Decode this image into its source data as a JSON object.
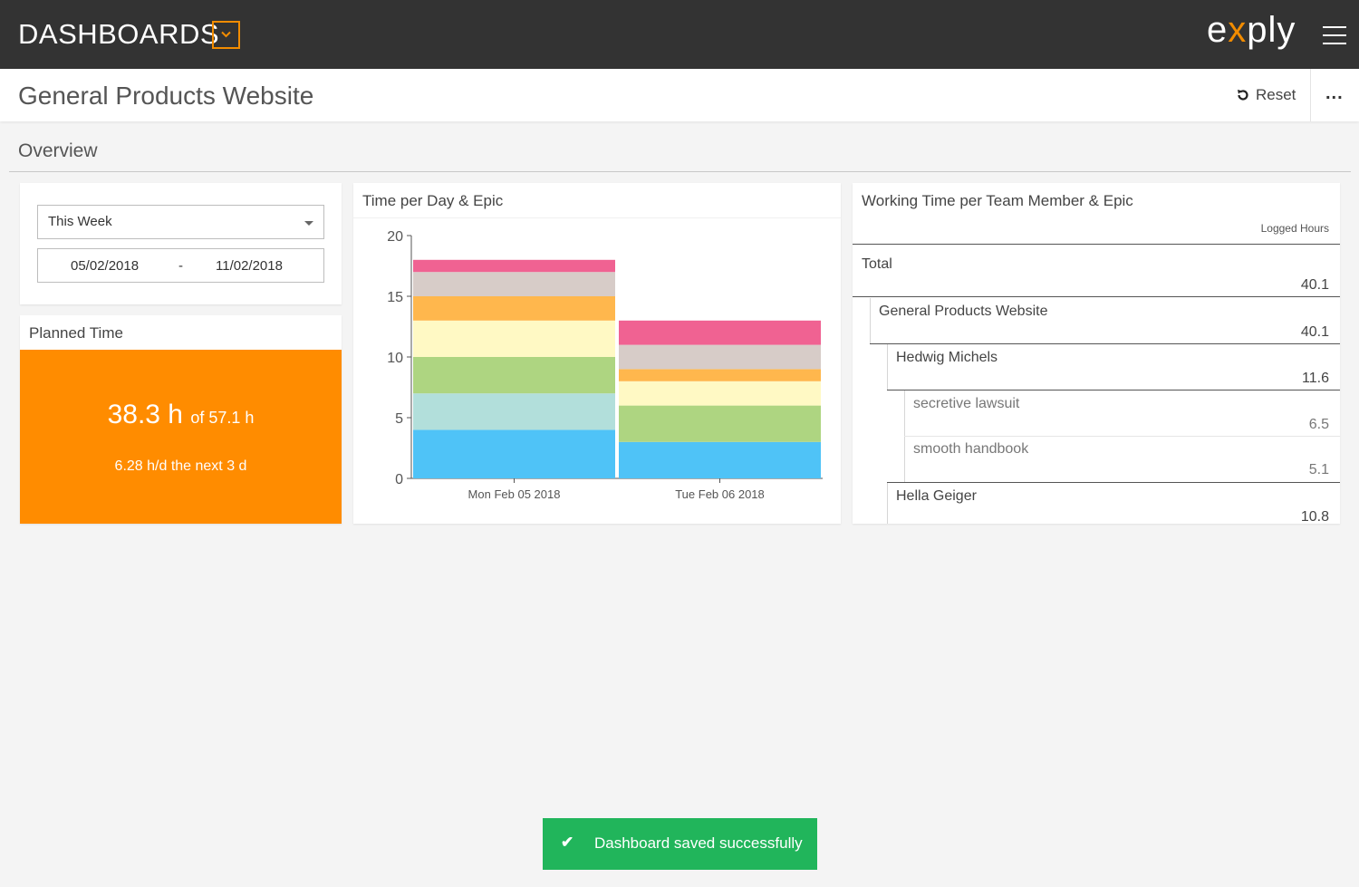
{
  "topbar": {
    "title": "DASHBOARDS",
    "logo_left": "e",
    "logo_x": "x",
    "logo_right": "ply",
    "accent": "#f28c00",
    "bg": "#333333"
  },
  "subbar": {
    "page_title": "General Products Website",
    "reset_label": "Reset",
    "more_label": "..."
  },
  "overview": {
    "title": "Overview"
  },
  "filter": {
    "period": "This Week",
    "date_from": "05/02/2018",
    "date_sep": "-",
    "date_to": "11/02/2018"
  },
  "planned": {
    "title": "Planned Time",
    "value": "38.3 h",
    "of_label": "of 57.1 h",
    "rate": "6.28 h/d the next 3 d",
    "bg": "#ff8c00"
  },
  "chart_data": {
    "type": "bar",
    "title": "Time per Day & Epic",
    "categories": [
      "Mon Feb 05 2018",
      "Tue Feb 06 2018"
    ],
    "stacked": true,
    "ylim": [
      0,
      20
    ],
    "yticks": [
      0,
      5,
      10,
      15,
      20
    ],
    "series": [
      {
        "color": "#4fc3f7",
        "values": [
          4.0,
          3.0
        ]
      },
      {
        "color": "#b2dfdb",
        "values": [
          3.0,
          0
        ]
      },
      {
        "color": "#aed581",
        "values": [
          3.0,
          3.0
        ]
      },
      {
        "color": "#fff9c4",
        "values": [
          3.0,
          2.0
        ]
      },
      {
        "color": "#ffb74d",
        "values": [
          2.0,
          1.0
        ]
      },
      {
        "color": "#d7ccc8",
        "values": [
          2.0,
          2.0
        ]
      },
      {
        "color": "#f06292",
        "values": [
          1.0,
          2.0
        ]
      }
    ]
  },
  "team": {
    "title": "Working Time per Team Member & Epic",
    "col_header": "Logged Hours",
    "rows": [
      {
        "label": "Total",
        "value": "40.1"
      },
      {
        "label": "General Products Website",
        "value": "40.1"
      },
      {
        "label": "Hedwig Michels",
        "value": "11.6"
      },
      {
        "label": "secretive lawsuit",
        "value": "6.5"
      },
      {
        "label": "smooth handbook",
        "value": "5.1"
      },
      {
        "label": "Hella Geiger",
        "value": "10.8"
      }
    ]
  },
  "toast": {
    "check": "✔",
    "message": "Dashboard saved successfully",
    "bg": "#21b55b"
  }
}
